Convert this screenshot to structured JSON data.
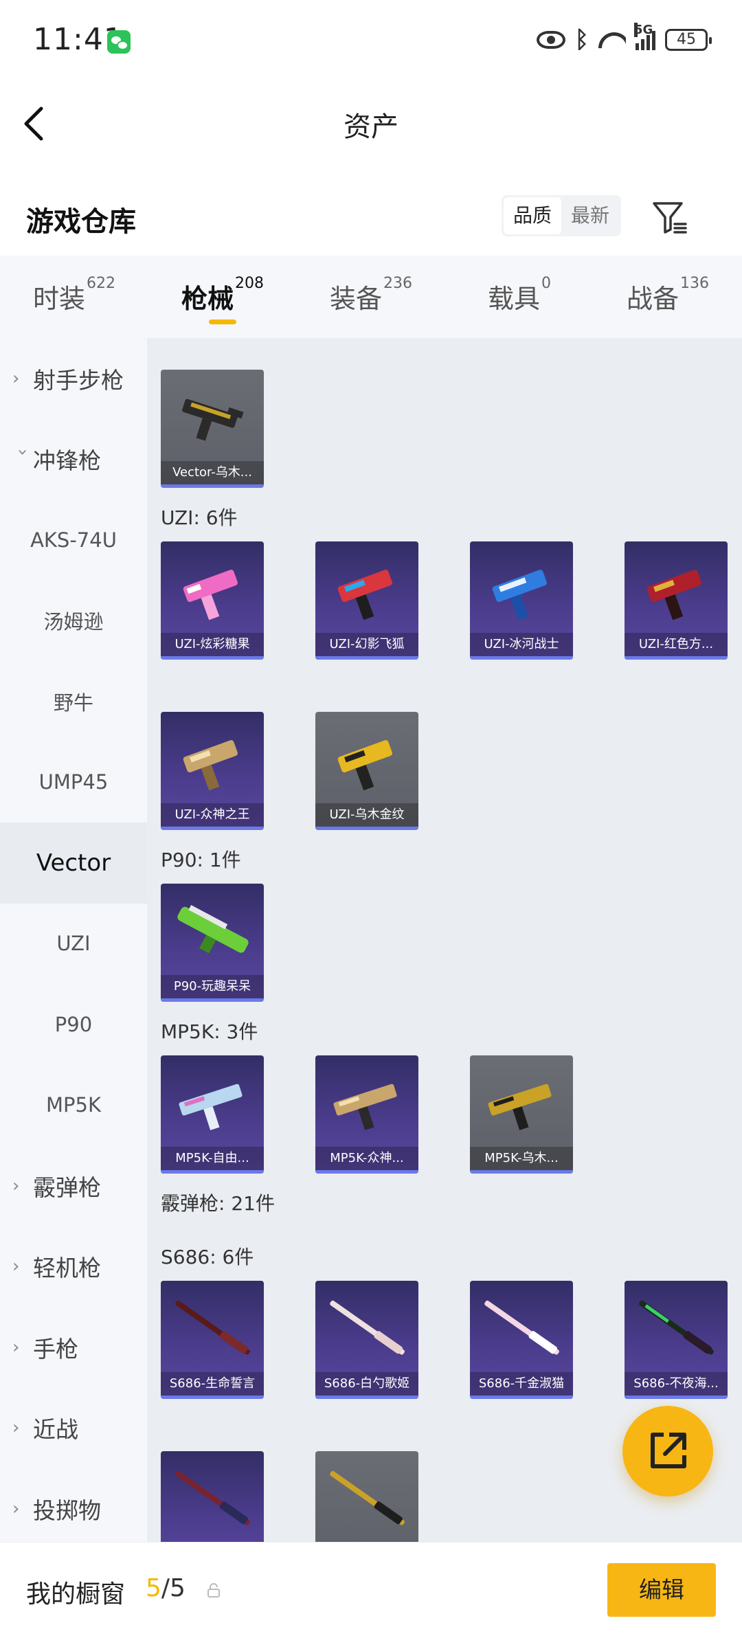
{
  "status_bar": {
    "time": "11:41",
    "battery": "45",
    "network": "5G"
  },
  "header": {
    "title": "资产"
  },
  "section": {
    "title": "游戏仓库",
    "sort_options": [
      "品质",
      "最新"
    ]
  },
  "tabs": [
    {
      "label": "时装",
      "count": "622"
    },
    {
      "label": "枪械",
      "count": "208"
    },
    {
      "label": "装备",
      "count": "236"
    },
    {
      "label": "载具",
      "count": "0"
    },
    {
      "label": "战备",
      "count": "136"
    }
  ],
  "sidebar": {
    "items": [
      {
        "label": "射手步枪"
      },
      {
        "label": "冲锋枪"
      },
      {
        "label": "AKS-74U"
      },
      {
        "label": "汤姆逊"
      },
      {
        "label": "野牛"
      },
      {
        "label": "UMP45"
      },
      {
        "label": "Vector"
      },
      {
        "label": "UZI"
      },
      {
        "label": "P90"
      },
      {
        "label": "MP5K"
      },
      {
        "label": "霰弹枪"
      },
      {
        "label": "轻机枪"
      },
      {
        "label": "手枪"
      },
      {
        "label": "近战"
      },
      {
        "label": "投掷物"
      }
    ],
    "selected": "Vector"
  },
  "groups": {
    "uzi": "UZI: 6件",
    "p90": "P90: 1件",
    "mp5k": "MP5K: 3件",
    "shotgun": "霰弹枪: 21件",
    "s686": "S686: 6件"
  },
  "cards": {
    "vector_0": "Vector-乌木...",
    "uzi_0": "UZI-炫彩糖果",
    "uzi_1": "UZI-幻影飞狐",
    "uzi_2": "UZI-冰河战士",
    "uzi_3": "UZI-红色方...",
    "uzi_4": "UZI-众神之王",
    "uzi_5": "UZI-乌木金纹",
    "p90_0": "P90-玩趣呆呆",
    "mp5k_0": "MP5K-自由...",
    "mp5k_1": "MP5K-众神...",
    "mp5k_2": "MP5K-乌木...",
    "s686_0": "S686-生命誓言",
    "s686_1": "S686-白勺歌姬",
    "s686_2": "S686-千金淑猫",
    "s686_3": "S686-不夜海..."
  },
  "bottom_bar": {
    "showcase_label": "我的橱窗",
    "showcase_used": "5",
    "showcase_total": "/5",
    "edit_label": "编辑"
  },
  "colors": {
    "accent": "#f8b614",
    "rare": "#4b3c8c",
    "common": "#62656c",
    "underline": "#6a7ae8"
  },
  "icons": [
    "back-icon",
    "filter-icon",
    "share-external-icon",
    "lock-icon",
    "chevron-right-icon",
    "chevron-down-icon"
  ]
}
